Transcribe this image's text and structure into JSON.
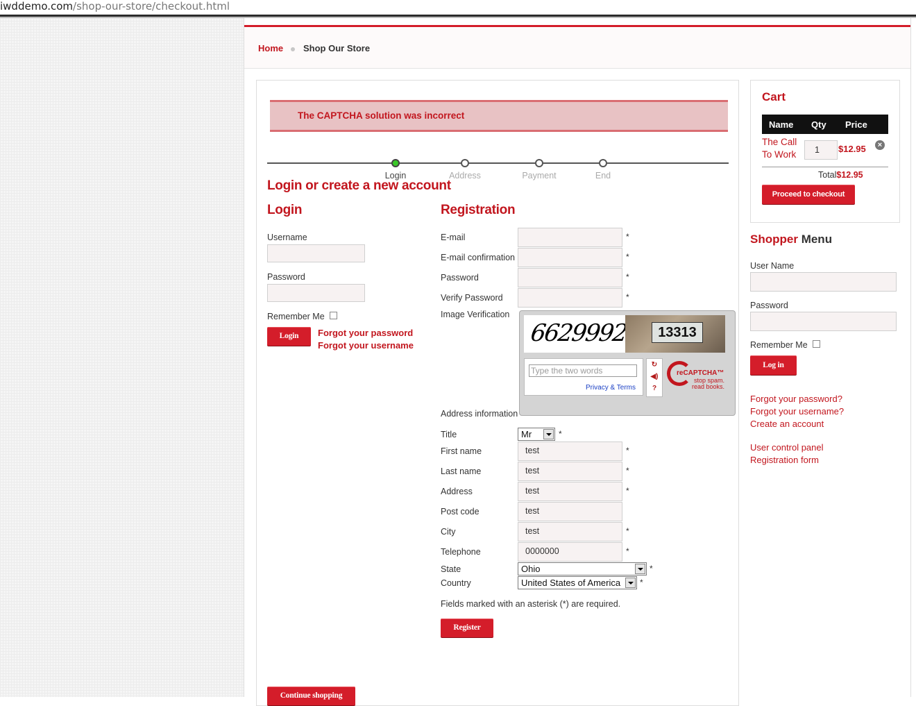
{
  "url": {
    "host": "iwddemo.com",
    "path": "/shop-our-store/checkout.html"
  },
  "breadcrumb": {
    "home": "Home",
    "current": "Shop Our Store"
  },
  "alert": "The CAPTCHA solution was incorrect",
  "steps": [
    {
      "label": "Login",
      "active": true
    },
    {
      "label": "Address",
      "active": false
    },
    {
      "label": "Payment",
      "active": false
    },
    {
      "label": "End",
      "active": false
    }
  ],
  "heading": "Login or create a new account",
  "login": {
    "title": "Login",
    "username_label": "Username",
    "password_label": "Password",
    "remember_label": "Remember Me",
    "button": "Login",
    "forgot_password": "Forgot your password",
    "forgot_username": "Forgot your username"
  },
  "registration": {
    "title": "Registration",
    "email_label": "E-mail",
    "email_confirm_label": "E-mail confirmation",
    "password_label": "Password",
    "verify_password_label": "Verify Password",
    "image_verification_label": "Image Verification",
    "asterisk": "*",
    "captcha": {
      "word1": "6629992",
      "word2": "13313",
      "placeholder": "Type the two words",
      "privacy": "Privacy & Terms",
      "logo": "reCAPTCHA™",
      "tagline1": "stop spam.",
      "tagline2": "read books.",
      "icons": [
        "refresh-icon",
        "audio-icon",
        "help-icon"
      ]
    },
    "address_info_label": "Address information",
    "title_label": "Title",
    "title_value": "Mr",
    "first_name_label": "First name",
    "first_name_value": "test",
    "last_name_label": "Last name",
    "last_name_value": "test",
    "address_label": "Address",
    "address_value": "test",
    "post_code_label": "Post code",
    "post_code_value": "test",
    "city_label": "City",
    "city_value": "test",
    "telephone_label": "Telephone",
    "telephone_value": "0000000",
    "state_label": "State",
    "state_value": "Ohio",
    "country_label": "Country",
    "country_value": "United States of America",
    "required_note": "Fields marked with an asterisk (*) are required.",
    "register_button": "Register",
    "continue_button": "Continue shopping"
  },
  "cart": {
    "title": "Cart",
    "headers": {
      "name": "Name",
      "qty": "Qty",
      "price": "Price"
    },
    "item": {
      "name": "The Call To Work",
      "qty": "1",
      "price": "$12.95"
    },
    "total_label": "Total",
    "total_value": "$12.95",
    "checkout_button": "Proceed to checkout"
  },
  "shopper_menu": {
    "title_a": "Shopper",
    "title_b": "Menu",
    "username_label": "User Name",
    "password_label": "Password",
    "remember_label": "Remember Me",
    "button": "Log in",
    "links1": [
      "Forgot your password?",
      "Forgot your username?",
      "Create an account"
    ],
    "links2": [
      "User control panel",
      "Registration form"
    ]
  },
  "colors": {
    "accent": "#d41d2a",
    "link": "#c2161e",
    "alert_bg": "#e8c2c4"
  }
}
